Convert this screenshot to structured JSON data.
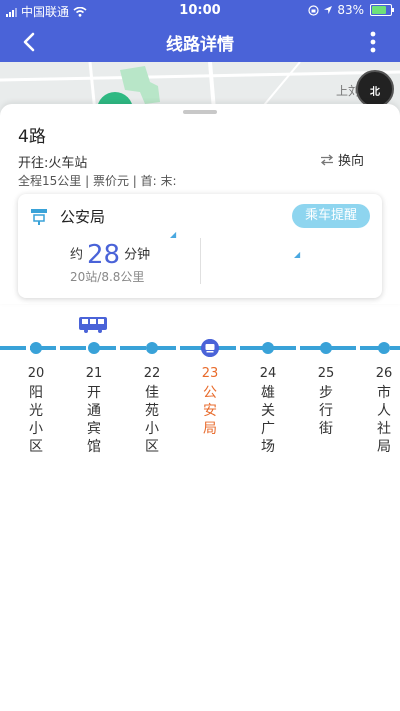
{
  "status_bar": {
    "carrier": "中国联通",
    "time": "10:00",
    "battery": "83%"
  },
  "header": {
    "title": "线路详情"
  },
  "map": {
    "place_label": "上刘",
    "compass_label": "北"
  },
  "route": {
    "name": "4路",
    "direction": "开往:火车站",
    "info": "全程15公里 | 票价元 | 首: 末:",
    "switch_label": "换向"
  },
  "stop_card": {
    "station": "公安局",
    "remind_label": "乘车提醒",
    "eta_prefix": "约",
    "eta_minutes": "28",
    "eta_suffix": "分钟",
    "eta_detail": "20站/8.8公里"
  },
  "stops": [
    {
      "num": "20",
      "name": "阳\n光\n小\n区"
    },
    {
      "num": "21",
      "name": "开\n通\n宾\n馆"
    },
    {
      "num": "22",
      "name": "佳\n苑\n小\n区"
    },
    {
      "num": "23",
      "name": "公\n安\n局"
    },
    {
      "num": "24",
      "name": "雄\n关\n广\n场"
    },
    {
      "num": "25",
      "name": "步\n行\n街"
    },
    {
      "num": "26",
      "name": "市\n人\n社\n局"
    }
  ],
  "colors": {
    "primary": "#4a63d8",
    "track": "#39a2d8",
    "highlight": "#e86b2c",
    "remind": "#8ed5ef"
  }
}
